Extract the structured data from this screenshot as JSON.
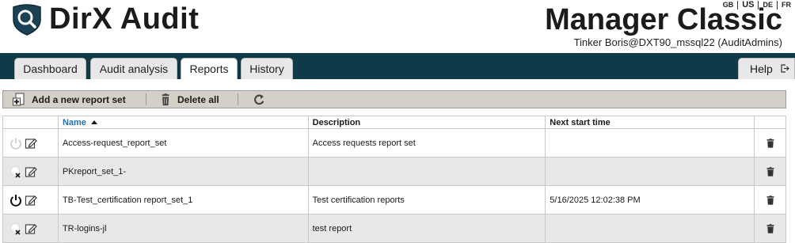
{
  "app": {
    "name": "DirX Audit",
    "product": "Manager Classic",
    "user": "Tinker Boris@DXT90_mssql22 (AuditAdmins)"
  },
  "languages": [
    "GB",
    "US",
    "DE",
    "FR"
  ],
  "active_language": "US",
  "tabs": [
    {
      "label": "Dashboard",
      "active": false
    },
    {
      "label": "Audit analysis",
      "active": false
    },
    {
      "label": "Reports",
      "active": true
    },
    {
      "label": "History",
      "active": false
    }
  ],
  "help_label": "Help",
  "toolbar": {
    "add_label": "Add a new report set",
    "delete_all_label": "Delete all"
  },
  "table": {
    "columns": [
      "Name",
      "Description",
      "Next start time"
    ],
    "sorted_column": "Name",
    "rows": [
      {
        "name": "Access-request_report_set",
        "description": "Access requests report set",
        "next_start": "",
        "status": "inactive"
      },
      {
        "name": "PKreport_set_1-",
        "description": "",
        "next_start": "",
        "status": "unscheduled"
      },
      {
        "name": "TB-Test_certification report_set_1",
        "description": "Test certification reports",
        "next_start": "5/16/2025 12:02:38 PM",
        "status": "active"
      },
      {
        "name": "TR-logins-jl",
        "description": "test report",
        "next_start": "",
        "status": "unscheduled"
      }
    ]
  },
  "colors": {
    "navbar": "#0f3a4a",
    "toolbar": "#d4d0c8",
    "sorted_header": "#1f6fb8",
    "alt_row": "#e8e8e8"
  }
}
